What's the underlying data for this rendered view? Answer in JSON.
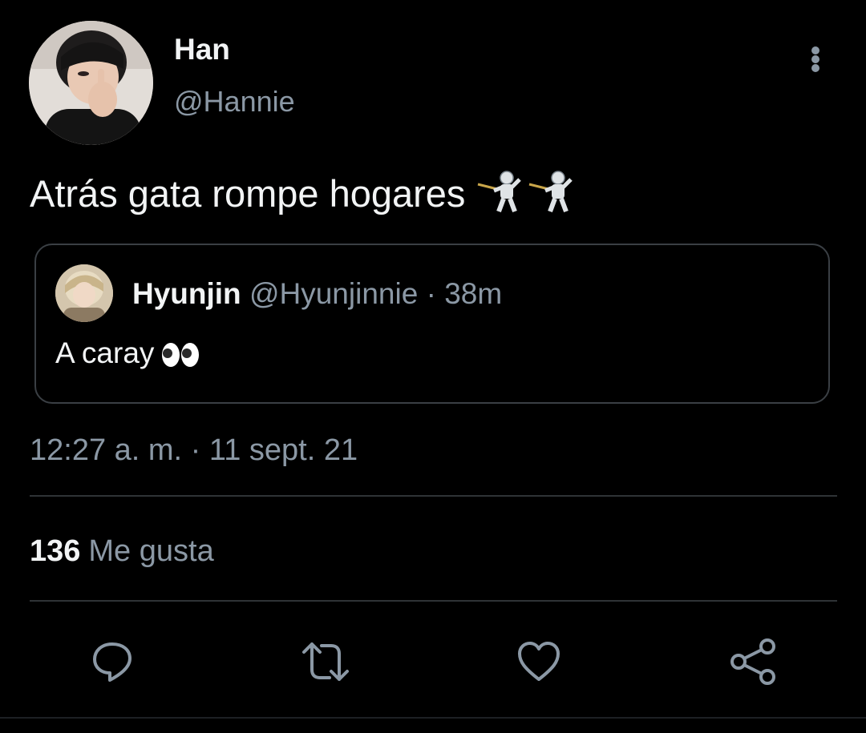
{
  "tweet": {
    "author": {
      "display_name": "Han",
      "handle": "@Hannie",
      "avatar_icon": "user-avatar-photo"
    },
    "more_icon": "more-vertical-icon",
    "text": "Atrás gata rompe hogares",
    "emojis": [
      "fencer-emoji",
      "fencer-emoji"
    ],
    "quoted_tweet": {
      "display_name": "Hyunjin",
      "handle": "@Hyunjinnie",
      "separator": "·",
      "time": "38m",
      "text": "A caray",
      "emoji": "eyes-emoji",
      "avatar_icon": "user-avatar-photo"
    },
    "timestamp": "12:27 a. m. · 11 sept. 21",
    "stats": {
      "likes_count": "136",
      "likes_label": "Me gusta"
    },
    "actions": [
      {
        "name": "reply",
        "icon": "reply-icon"
      },
      {
        "name": "retweet",
        "icon": "retweet-icon"
      },
      {
        "name": "like",
        "icon": "heart-icon"
      },
      {
        "name": "share",
        "icon": "share-icon"
      }
    ]
  },
  "colors": {
    "background": "#000000",
    "primary_text": "#f2f4f5",
    "secondary_text": "#8b98a5",
    "border": "#2f3336",
    "icon": "#8b98a5"
  }
}
